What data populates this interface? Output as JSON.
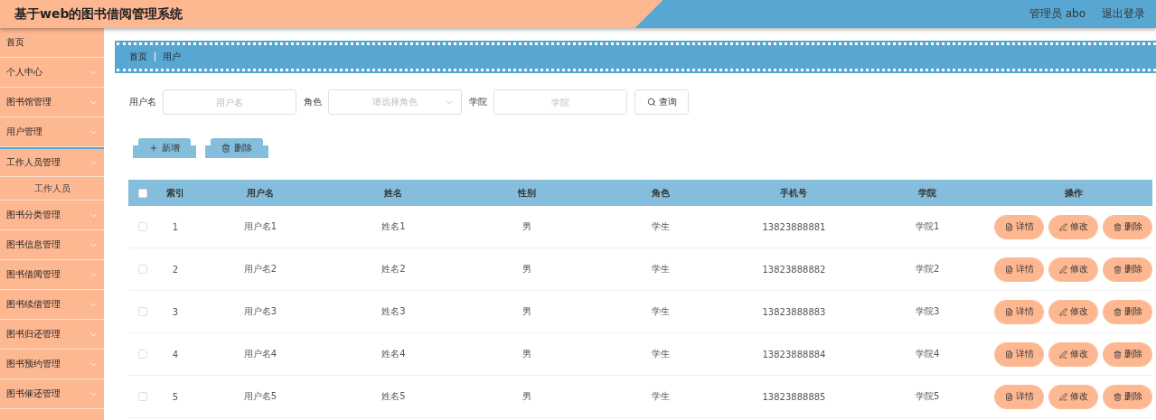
{
  "header": {
    "title": "基于web的图书借阅管理系统",
    "user": "管理员 abo",
    "logout": "退出登录"
  },
  "sidebar": {
    "items": [
      {
        "label": "首页",
        "has_arrow": false,
        "expanded": false
      },
      {
        "label": "个人中心",
        "has_arrow": true,
        "expanded": false
      },
      {
        "label": "图书馆管理",
        "has_arrow": true,
        "expanded": false
      },
      {
        "label": "用户管理",
        "has_arrow": true,
        "expanded": false
      },
      {
        "label": "工作人员管理",
        "has_arrow": true,
        "expanded": true,
        "children": [
          {
            "label": "工作人员"
          }
        ]
      },
      {
        "label": "图书分类管理",
        "has_arrow": true,
        "expanded": false
      },
      {
        "label": "图书信息管理",
        "has_arrow": true,
        "expanded": false
      },
      {
        "label": "图书借阅管理",
        "has_arrow": true,
        "expanded": false
      },
      {
        "label": "图书续借管理",
        "has_arrow": true,
        "expanded": false
      },
      {
        "label": "图书归还管理",
        "has_arrow": true,
        "expanded": false
      },
      {
        "label": "图书预约管理",
        "has_arrow": true,
        "expanded": false
      },
      {
        "label": "图书催还管理",
        "has_arrow": true,
        "expanded": false
      }
    ]
  },
  "breadcrumb": [
    "首页",
    "用户"
  ],
  "search": {
    "fields": [
      {
        "kind": "input",
        "label": "用户名",
        "placeholder": "用户名"
      },
      {
        "kind": "select",
        "label": "角色",
        "placeholder": "请选择角色"
      },
      {
        "kind": "input",
        "label": "学院",
        "placeholder": "学院"
      }
    ],
    "button": "查询"
  },
  "actions": [
    {
      "kind": "add",
      "label": "新增"
    },
    {
      "kind": "delete",
      "label": "删除"
    }
  ],
  "table": {
    "header_checked": false,
    "columns": [
      "索引",
      "用户名",
      "姓名",
      "性别",
      "角色",
      "手机号",
      "学院",
      "操作"
    ],
    "rows": [
      {
        "checked": false,
        "cells": [
          "1",
          "用户名1",
          "姓名1",
          "男",
          "学生",
          "13823888881",
          "学院1"
        ],
        "actions": [
          {
            "kind": "detail",
            "label": "详情"
          },
          {
            "kind": "edit",
            "label": "修改"
          },
          {
            "kind": "delete",
            "label": "删除"
          }
        ]
      },
      {
        "checked": false,
        "cells": [
          "2",
          "用户名2",
          "姓名2",
          "男",
          "学生",
          "13823888882",
          "学院2"
        ],
        "actions": [
          {
            "kind": "detail",
            "label": "详情"
          },
          {
            "kind": "edit",
            "label": "修改"
          },
          {
            "kind": "delete",
            "label": "删除"
          }
        ]
      },
      {
        "checked": false,
        "cells": [
          "3",
          "用户名3",
          "姓名3",
          "男",
          "学生",
          "13823888883",
          "学院3"
        ],
        "actions": [
          {
            "kind": "detail",
            "label": "详情"
          },
          {
            "kind": "edit",
            "label": "修改"
          },
          {
            "kind": "delete",
            "label": "删除"
          }
        ]
      },
      {
        "checked": false,
        "cells": [
          "4",
          "用户名4",
          "姓名4",
          "男",
          "学生",
          "13823888884",
          "学院4"
        ],
        "actions": [
          {
            "kind": "detail",
            "label": "详情"
          },
          {
            "kind": "edit",
            "label": "修改"
          },
          {
            "kind": "delete",
            "label": "删除"
          }
        ]
      },
      {
        "checked": false,
        "cells": [
          "5",
          "用户名5",
          "姓名5",
          "男",
          "学生",
          "13823888885",
          "学院5"
        ],
        "actions": [
          {
            "kind": "detail",
            "label": "详情"
          },
          {
            "kind": "edit",
            "label": "修改"
          },
          {
            "kind": "delete",
            "label": "删除"
          }
        ]
      }
    ]
  }
}
